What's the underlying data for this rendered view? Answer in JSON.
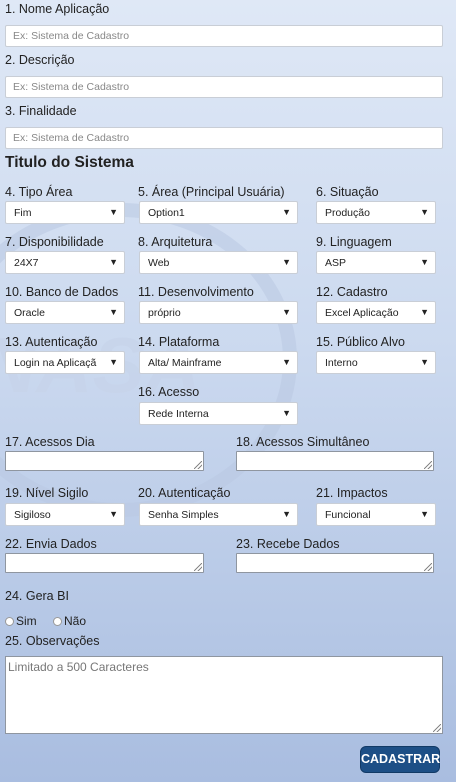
{
  "fields": {
    "f1": {
      "label": "1. Nome Aplicação",
      "placeholder": "Ex: Sistema de Cadastro"
    },
    "f2": {
      "label": "2. Descrição",
      "placeholder": "Ex: Sistema de Cadastro"
    },
    "f3": {
      "label": "3. Finalidade",
      "placeholder": "Ex: Sistema de Cadastro"
    }
  },
  "section_title": "Titulo do Sistema",
  "selects": {
    "f4": {
      "label": "4. Tipo Área",
      "value": "Fim"
    },
    "f5": {
      "label": "5. Área (Principal Usuária)",
      "value": "Option1"
    },
    "f6": {
      "label": "6. Situação",
      "value": "Produção"
    },
    "f7": {
      "label": "7. Disponibilidade",
      "value": "24X7"
    },
    "f8": {
      "label": "8. Arquitetura",
      "value": "Web"
    },
    "f9": {
      "label": "9. Linguagem",
      "value": "ASP"
    },
    "f10": {
      "label": "10. Banco de Dados",
      "value": "Oracle"
    },
    "f11": {
      "label": "11. Desenvolvimento",
      "value": "próprio"
    },
    "f12": {
      "label": "12. Cadastro",
      "value": "Excel Aplicação"
    },
    "f13": {
      "label": "13. Autenticação",
      "value": "Login na Aplicaçã"
    },
    "f14": {
      "label": "14. Plataforma",
      "value": "Alta/ Mainframe"
    },
    "f15": {
      "label": "15. Público Alvo",
      "value": "Interno"
    },
    "f16": {
      "label": "16. Acesso",
      "value": "Rede Interna"
    },
    "f19": {
      "label": "19. Nível Sigilo",
      "value": "Sigiloso"
    },
    "f20": {
      "label": "20. Autenticação",
      "value": "Senha Simples"
    },
    "f21": {
      "label": "21. Impactos",
      "value": "Funcional"
    }
  },
  "textareas": {
    "f17": {
      "label": "17. Acessos Dia"
    },
    "f18": {
      "label": "18. Acessos Simultâneo"
    },
    "f22": {
      "label": "22. Envia Dados"
    },
    "f23": {
      "label": "23. Recebe Dados"
    }
  },
  "gera_bi": {
    "label": "24. Gera BI",
    "yes": "Sim",
    "no": "Não"
  },
  "observacoes": {
    "label": "25. Observações",
    "placeholder": "Limitado a 500 Caracteres"
  },
  "submit_label": "CADASTRAR"
}
